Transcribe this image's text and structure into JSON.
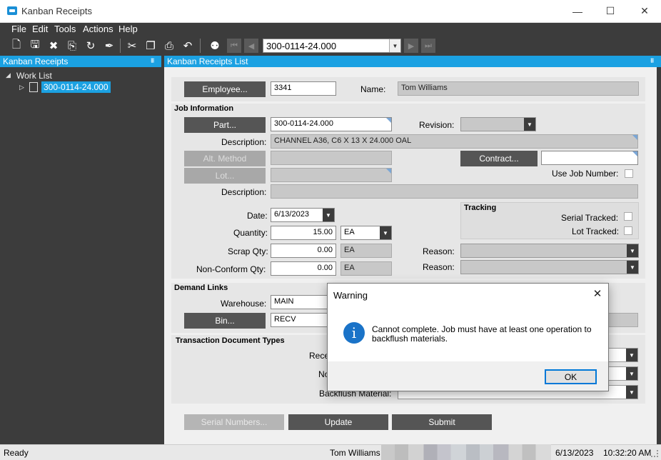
{
  "window": {
    "title": "Kanban Receipts",
    "minimize_icon": "minimize-icon",
    "maximize_icon": "maximize-icon",
    "close_icon": "close-icon"
  },
  "menu": [
    "File",
    "Edit",
    "Tools",
    "Actions",
    "Help"
  ],
  "toolbar": {
    "record": "300-0114-24.000",
    "icons": [
      "new-icon",
      "save-icon",
      "delete-icon",
      "attach-icon",
      "refresh-icon",
      "clear-icon",
      "cut-icon",
      "copy-icon",
      "paste-icon",
      "undo-icon",
      "search-icon",
      "first-record-icon",
      "prev-record-icon",
      "next-record-icon",
      "last-record-icon"
    ]
  },
  "left_panel": {
    "title": "Kanban Receipts",
    "tree": {
      "root": "Work List",
      "item": "300-0114-24.000"
    }
  },
  "right_panel": {
    "title": "Kanban Receipts List"
  },
  "form": {
    "employee_button": "Employee...",
    "employee_id": "3341",
    "name_label": "Name:",
    "name_value": "Tom Williams",
    "job_info_header": "Job Information",
    "part_button": "Part...",
    "part_value": "300-0114-24.000",
    "revision_label": "Revision:",
    "description_label": "Description:",
    "description_value": "CHANNEL A36, C6 X 13 X 24.000 OAL",
    "alt_method_button": "Alt. Method",
    "contract_button": "Contract...",
    "lot_button": "Lot...",
    "use_job_number_label": "Use Job Number:",
    "description2_label": "Description:",
    "date_label": "Date:",
    "date_value": "6/13/2023",
    "tracking_header": "Tracking",
    "serial_tracked_label": "Serial Tracked:",
    "lot_tracked_label": "Lot Tracked:",
    "quantity_label": "Quantity:",
    "quantity_value": "15.00",
    "quantity_uom": "EA",
    "scrap_label": "Scrap Qty:",
    "scrap_value": "0.00",
    "scrap_uom": "EA",
    "nonconform_label": "Non-Conform Qty:",
    "nonconform_value": "0.00",
    "nonconform_uom": "EA",
    "reason_label": "Reason:",
    "reason2_label": "Reason:",
    "demand_header": "Demand Links",
    "warehouse_label": "Warehouse:",
    "warehouse_value": "MAIN",
    "bin_button": "Bin...",
    "bin_value": "RECV",
    "tdt_header": "Transaction Document Types",
    "tdt_label1": "Rece",
    "tdt_label2": "No",
    "tdt_label3": "Backflush Material:",
    "serial_numbers_button": "Serial Numbers...",
    "update_button": "Update",
    "submit_button": "Submit"
  },
  "status": {
    "left": "Ready",
    "user": "Tom Williams",
    "date": "6/13/2023",
    "time": "10:32:20 AM"
  },
  "dialog": {
    "title": "Warning",
    "message": "Cannot complete. Job must have at least one operation to backflush materials.",
    "ok": "OK",
    "icon": "info-icon",
    "icon_color": "#1a73c8"
  },
  "colors": {
    "accent": "#1ba1e2",
    "dark": "#3c3c3c",
    "button": "#555555"
  }
}
